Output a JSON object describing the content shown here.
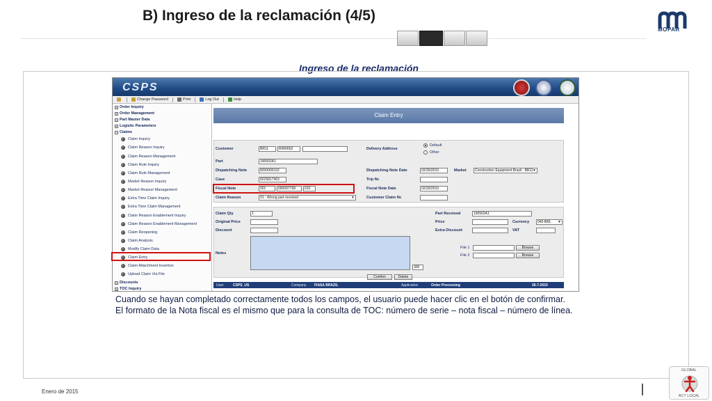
{
  "slide": {
    "title": "B) Ingreso de la reclamación (4/5)",
    "section_title": "Ingreso de la reclamación",
    "caption_line1": "Cuando se hayan completado correctamente todos los campos, el usuario puede hacer clic en el botón de confirmar.",
    "caption_line2": "El formato de la Nota fiscal es el mismo que para la consulta de TOC:  número de serie – nota fiscal – número de línea.",
    "footer_date": "Enero de 2015",
    "logo_text": "MOPAR",
    "badge_top": "GLOBAL",
    "badge_bottom": "ACT LOCAL",
    "progress": {
      "total_steps": 4,
      "active_step": 2
    }
  },
  "app": {
    "logo": "CSPS",
    "toolbar": {
      "change_password": "Change Password",
      "print": "Print",
      "log_out": "Log Out",
      "help": "Help"
    },
    "nav": [
      "Order Inquiry",
      "Order Management",
      "Part Master Data",
      "Logistic Parameters",
      "Claims",
      "Claim Inquiry",
      "Claim Reason Inquiry",
      "Claim Reason Management",
      "Claim Rule Inquiry",
      "Claim Rule Management",
      "Market Reason Inquiry",
      "Market Reason Management",
      "Extra Time Claim Inquiry",
      "Extra Time Claim Management",
      "Claim Reason Enablement Inquiry",
      "Claim Reason Enablement Management",
      "Claim Reopening",
      "Claim Analysis",
      "Modify Claim Data",
      "Claim Entry",
      "Claim Attachment Insertion",
      "Upload Claim Via File",
      "Discounts",
      "TOC Inquiry"
    ],
    "entry_title": "Claim Entry",
    "fields": {
      "customer_label": "Customer",
      "customer_1": "BR11",
      "customer_2": "R000602",
      "customer_3": "",
      "delivery_address_label": "Delivery Address",
      "default_label": "Default",
      "other_label": "Other",
      "part_label": "Part",
      "part_value": "190502A1",
      "dispatching_note_label": "Dispatching Note",
      "dispatching_note_value": "8200000102",
      "dispatching_note_date_label": "Dispatching Note Date",
      "dispatching_note_date_value": "02/26/2010",
      "market_label": "Market",
      "market_value": "Construction Equipment Brazil - BR11",
      "case_label": "Case",
      "case_value": "8225817963",
      "trip_nr_label": "Trip Nr.",
      "trip_nr_value": "",
      "fiscal_note_label": "Fiscal Note",
      "fiscal_note_1": "001",
      "fiscal_note_2": "000097768",
      "fiscal_note_3": "010",
      "fiscal_note_date_label": "Fiscal Note Date",
      "fiscal_note_date_value": "02/26/2010",
      "claim_reason_label": "Claim Reason",
      "claim_reason_value": "01 - Wrong part received",
      "customer_claim_nr_label": "Customer Claim Nr.",
      "customer_claim_nr_value": "",
      "claim_qty_label": "Claim Qty",
      "claim_qty_value": "1",
      "original_price_label": "Original Price",
      "original_price_value": "",
      "discount_label": "Discount",
      "discount_value": "",
      "part_received_label": "Part Received",
      "part_received_value": "190502A1",
      "price_label": "Price",
      "price_value": "",
      "currency_label": "Currency",
      "currency_value": "040-BRL",
      "extra_discount_label": "Extra Discount",
      "extra_discount_value": "",
      "vat_label": "VAT",
      "vat_value": "",
      "notes_label": "Notes",
      "notes_counter": "300",
      "file1_label": "File 1",
      "file2_label": "File 2",
      "browse_label": "Browse"
    },
    "buttons": {
      "confirm": "Confirm",
      "delete": "Delete"
    },
    "status": {
      "user_label": "User",
      "user_value": "CSPS_US",
      "company_label": "Company",
      "company_value": "FIASA BRAZIL",
      "application_label": "Application",
      "application_value": "Order Processing",
      "date_value": "26-7-2010"
    }
  },
  "colors": {
    "highlight": "#d01010",
    "app_banner": "#1f4a84",
    "header_bar": "#5a78a6",
    "status_bar": "#1f3d78",
    "title_text": "#1b2d6b"
  },
  "icons": {
    "progress": "chevron-arrow-icon",
    "nav_bullet": "circle-bullet-icon",
    "toolbar": [
      "house-icon",
      "key-icon",
      "printer-icon",
      "logout-icon",
      "help-icon"
    ]
  }
}
